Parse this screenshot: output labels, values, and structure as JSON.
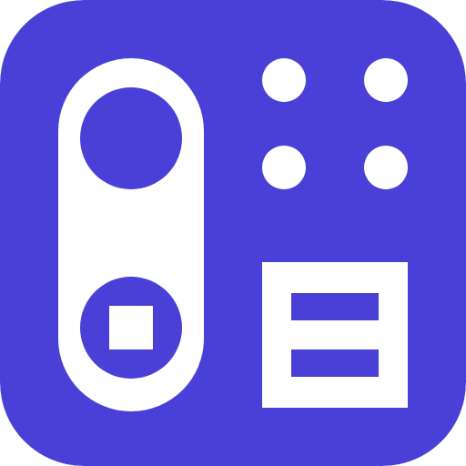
{
  "app_icon": {
    "name": "doorbell-intercom-app-icon",
    "icon": "doorbell-intercom-icon",
    "colors": {
      "background": "#4a3fd6",
      "foreground": "#ffffff"
    },
    "parts": {
      "doorbell": "doorbell-icon",
      "camera_lens": "camera-lens-icon",
      "button": "doorbell-button-icon",
      "keypad_dots": "keypad-dots-icon",
      "panel": "intercom-panel-icon"
    }
  }
}
